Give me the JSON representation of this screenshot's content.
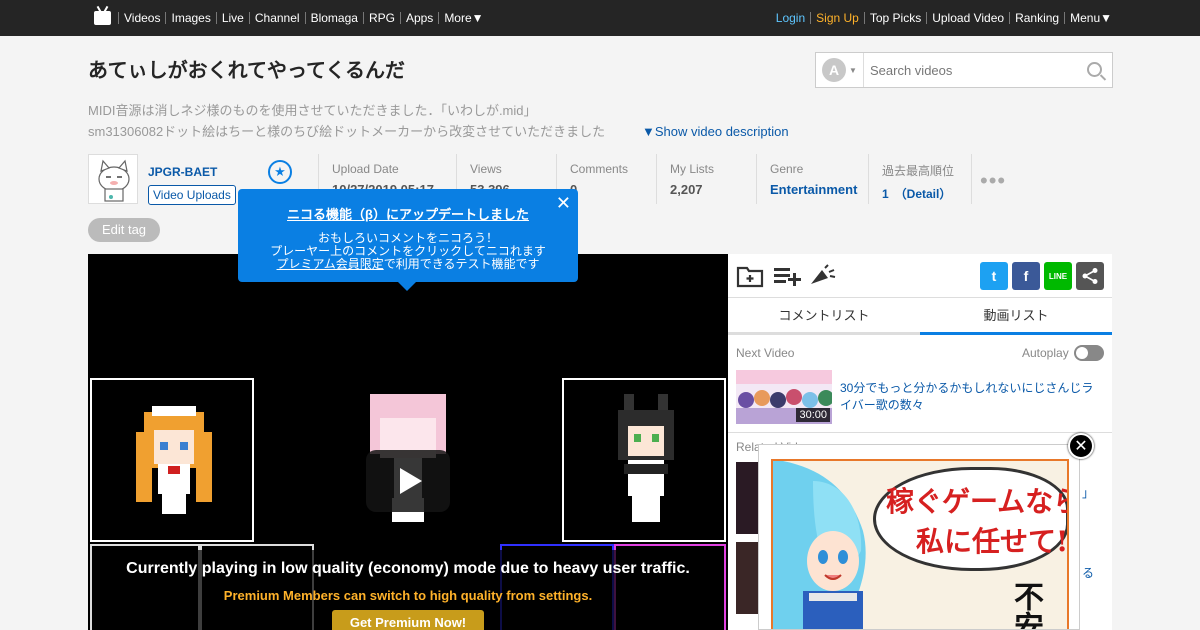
{
  "nav": {
    "left": [
      "Videos",
      "Images",
      "Live",
      "Channel",
      "Blomaga",
      "RPG",
      "Apps",
      "More▼"
    ],
    "login": "Login",
    "signup": "Sign Up",
    "right": [
      "Top Picks",
      "Upload Video",
      "Ranking",
      "Menu▼"
    ]
  },
  "video": {
    "title": "あてぃしがおくれてやってくるんだ",
    "description_line1": "MIDI音源は消しネジ様のものを使用させていただきました．「いわしが.mid」",
    "description_line2": "sm31306082ドット絵はちーと様のちび絵ドットメーカーから改変させていただきました",
    "show_description": "▼Show video description",
    "edit_tag": "Edit tag"
  },
  "search": {
    "type_letter": "A",
    "placeholder": "Search videos"
  },
  "owner": {
    "name": "JPGR-BAET",
    "uploads_label": "Video Uploads"
  },
  "meta": [
    {
      "key": "Upload Date",
      "value": "10/27/2019 05:17"
    },
    {
      "key": "Views",
      "value": "53,396"
    },
    {
      "key": "Comments",
      "value": "0"
    },
    {
      "key": "My Lists",
      "value": "2,207"
    },
    {
      "key": "Genre",
      "value": "Entertainment"
    },
    {
      "key": "過去最高順位",
      "value": "1　（Detail）"
    }
  ],
  "more": "•••",
  "tooltip": {
    "title": "ニコる機能（β）にアップデートしました",
    "line1": "おもしろいコメントをニコろう！",
    "line2": "プレーヤー上のコメントをクリックしてニコれます",
    "line3_link": "プレミアム会員限定",
    "line3_rest": "で利用できるテスト機能です",
    "close": "✕"
  },
  "player": {
    "economy_message": "Currently playing in low quality (economy) mode due to heavy user traffic.",
    "economy_sub": "Premium Members can switch to high quality from settings.",
    "get_premium": "Get Premium Now!"
  },
  "side": {
    "tabs": [
      "コメントリスト",
      "動画リスト"
    ],
    "next_label": "Next Video",
    "autoplay_label": "Autoplay",
    "next_title": "30分でもっと分かるかもしれないにじさんじライバー歌の数々",
    "next_duration": "30:00",
    "related_label": "Related Videos",
    "related_fragments": [
      "」",
      "る"
    ]
  },
  "share": {
    "twitter": "t",
    "facebook": "f",
    "line": "LINE"
  },
  "ad": {
    "line1": "稼ぐゲームなら",
    "line2": "私に任せて!",
    "side": "不安"
  },
  "colors": {
    "accent": "#0a7fe3",
    "link": "#0a59a8",
    "signup": "#ffb22a",
    "login": "#5ec6ff",
    "twitter": "#1da1f2",
    "facebook": "#3b5998",
    "line": "#00b900",
    "share": "#555555"
  }
}
